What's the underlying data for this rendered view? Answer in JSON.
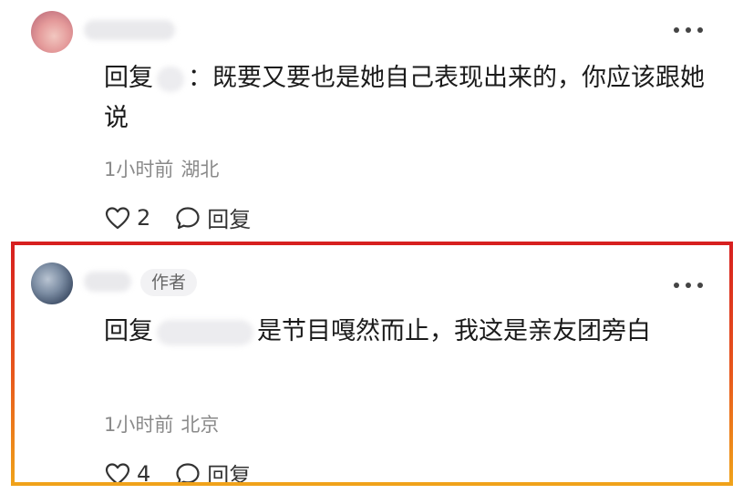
{
  "comments": [
    {
      "reply_prefix": "回复",
      "content": "：既要又要也是她自己表现出来的，你应该跟她说",
      "time": "1小时前",
      "location": "湖北",
      "likes": "2",
      "reply_button": "回复"
    },
    {
      "author_badge": "作者",
      "reply_prefix": "回复",
      "content": "是节目嘎然而止，我这是亲友团旁白",
      "time": "1小时前",
      "location": "北京",
      "likes": "4",
      "reply_button": "回复"
    }
  ],
  "colors": {
    "highlight_top": "#d71f1f",
    "highlight_bottom": "#f0a21a",
    "meta_text": "#8a8a8a"
  },
  "icons": {
    "like": "heart-outline-icon",
    "reply": "speech-bubble-outline-icon",
    "more": "more-dots-icon"
  }
}
